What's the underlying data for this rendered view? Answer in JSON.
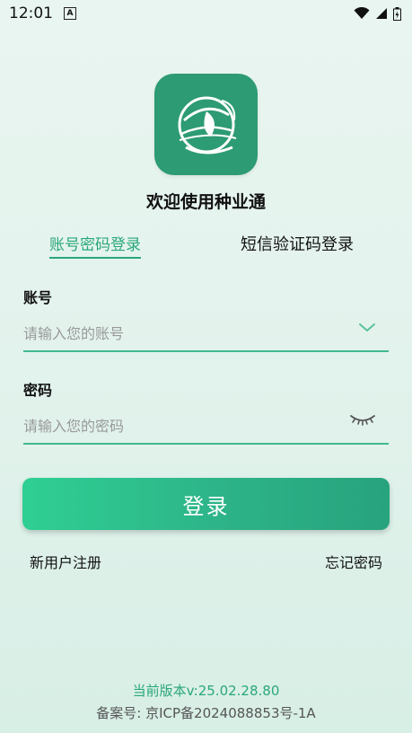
{
  "status_bar": {
    "time": "12:01",
    "notification_icon": "a-icon",
    "icons": [
      "wifi-icon",
      "signal-icon",
      "battery-icon"
    ]
  },
  "app": {
    "title": "欢迎使用种业通",
    "logo_icon": "seed-logo-icon",
    "brand_color": "#2d9b73",
    "accent_color": "#2aa77a"
  },
  "tabs": {
    "password_login": "账号密码登录",
    "sms_login": "短信验证码登录",
    "active": "password_login"
  },
  "form": {
    "account_label": "账号",
    "account_placeholder": "请输入您的账号",
    "password_label": "密码",
    "password_placeholder": "请输入您的密码"
  },
  "actions": {
    "login": "登录",
    "register": "新用户注册",
    "forgot_password": "忘记密码"
  },
  "footer": {
    "version": "当前版本v:25.02.28.80",
    "record": "备案号: 京ICP备2024088853号-1A"
  }
}
